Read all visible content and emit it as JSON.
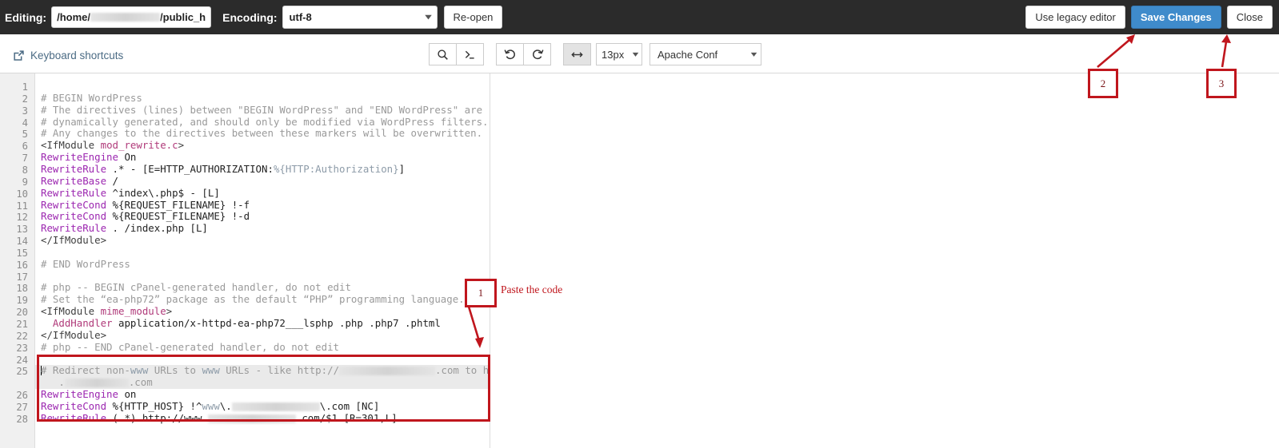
{
  "topbar": {
    "editing_label": "Editing:",
    "path_prefix": "/home/",
    "path_suffix": "/public_h",
    "encoding_label": "Encoding:",
    "encoding_value": "utf-8",
    "reopen_label": "Re-open",
    "legacy_label": "Use legacy editor",
    "save_label": "Save Changes",
    "close_label": "Close",
    "accent_color": "#3f8bcb",
    "bar_color": "#2b2b2b"
  },
  "toolbar": {
    "keyboard_shortcuts_label": "Keyboard shortcuts",
    "search_icon": "search-icon",
    "console_icon": "command-prompt-icon",
    "undo_icon": "undo-icon",
    "redo_icon": "redo-icon",
    "wrap_icon": "word-wrap-icon",
    "font_size_value": "13px",
    "language_value": "Apache Conf"
  },
  "editor": {
    "active_line": 25,
    "lines": [
      {
        "n": 1,
        "segments": []
      },
      {
        "n": 2,
        "segments": [
          {
            "t": "# BEGIN WordPress",
            "c": "c-comment"
          }
        ]
      },
      {
        "n": 3,
        "segments": [
          {
            "t": "# The directives (lines) between \"BEGIN WordPress\" and \"END WordPress\" are",
            "c": "c-comment"
          }
        ]
      },
      {
        "n": 4,
        "segments": [
          {
            "t": "# dynamically generated, and should only be modified via WordPress filters.",
            "c": "c-comment"
          }
        ]
      },
      {
        "n": 5,
        "segments": [
          {
            "t": "# Any changes to the directives between these markers will be overwritten.",
            "c": "c-comment"
          }
        ]
      },
      {
        "n": 6,
        "segments": [
          {
            "t": "<IfModule ",
            "c": "c-tag"
          },
          {
            "t": "mod_rewrite.c",
            "c": "c-attr"
          },
          {
            "t": ">",
            "c": "c-tag"
          }
        ]
      },
      {
        "n": 7,
        "segments": [
          {
            "t": "RewriteEngine",
            "c": "c-dir"
          },
          {
            "t": " On",
            "c": "c-plain"
          }
        ]
      },
      {
        "n": 8,
        "segments": [
          {
            "t": "RewriteRule",
            "c": "c-dir"
          },
          {
            "t": " .* - [E=HTTP_AUTHORIZATION:",
            "c": "c-plain"
          },
          {
            "t": "%{HTTP:Authorization}",
            "c": "c-var"
          },
          {
            "t": "]",
            "c": "c-plain"
          }
        ]
      },
      {
        "n": 9,
        "segments": [
          {
            "t": "RewriteBase",
            "c": "c-dir"
          },
          {
            "t": " /",
            "c": "c-plain"
          }
        ]
      },
      {
        "n": 10,
        "segments": [
          {
            "t": "RewriteRule",
            "c": "c-dir"
          },
          {
            "t": " ^index\\.php$ - [L]",
            "c": "c-plain"
          }
        ]
      },
      {
        "n": 11,
        "segments": [
          {
            "t": "RewriteCond",
            "c": "c-dir"
          },
          {
            "t": " %{REQUEST_FILENAME} !-f",
            "c": "c-plain"
          }
        ]
      },
      {
        "n": 12,
        "segments": [
          {
            "t": "RewriteCond",
            "c": "c-dir"
          },
          {
            "t": " %{REQUEST_FILENAME} !-d",
            "c": "c-plain"
          }
        ]
      },
      {
        "n": 13,
        "segments": [
          {
            "t": "RewriteRule",
            "c": "c-dir"
          },
          {
            "t": " . /index.php [L]",
            "c": "c-plain"
          }
        ]
      },
      {
        "n": 14,
        "segments": [
          {
            "t": "</IfModule>",
            "c": "c-tag"
          }
        ]
      },
      {
        "n": 15,
        "segments": []
      },
      {
        "n": 16,
        "segments": [
          {
            "t": "# END WordPress",
            "c": "c-comment"
          }
        ]
      },
      {
        "n": 17,
        "segments": []
      },
      {
        "n": 18,
        "segments": [
          {
            "t": "# php -- BEGIN cPanel-generated handler, do not edit",
            "c": "c-comment"
          }
        ]
      },
      {
        "n": 19,
        "segments": [
          {
            "t": "# Set the “ea-php72” package as the default “PHP” programming language.",
            "c": "c-comment"
          }
        ]
      },
      {
        "n": 20,
        "segments": [
          {
            "t": "<IfModule ",
            "c": "c-tag"
          },
          {
            "t": "mime_module",
            "c": "c-attr"
          },
          {
            "t": ">",
            "c": "c-tag"
          }
        ]
      },
      {
        "n": 21,
        "segments": [
          {
            "t": "  AddHandler",
            "c": "c-attr"
          },
          {
            "t": " application/x-httpd-ea-php72___lsphp .php .php7 .phtml",
            "c": "c-plain"
          }
        ]
      },
      {
        "n": 22,
        "segments": [
          {
            "t": "</IfModule>",
            "c": "c-tag"
          }
        ]
      },
      {
        "n": 23,
        "segments": [
          {
            "t": "# php -- END cPanel-generated handler, do not edit",
            "c": "c-comment"
          }
        ]
      },
      {
        "n": 24,
        "segments": []
      },
      {
        "n": 25,
        "segments": [
          {
            "t": "# Redirect non-",
            "c": "c-comment"
          },
          {
            "t": "www",
            "c": "c-var"
          },
          {
            "t": " URLs to ",
            "c": "c-comment"
          },
          {
            "t": "www",
            "c": "c-var"
          },
          {
            "t": " URLs - like http://",
            "c": "c-comment"
          },
          {
            "t": "[redacted]",
            "c": "redacted"
          },
          {
            "t": ".com to http://www",
            "c": "c-comment"
          }
        ],
        "wrapped": [
          {
            "t": "   .",
            "c": "c-comment"
          },
          {
            "t": "[redacted]",
            "c": "redacted"
          },
          {
            "t": ".com",
            "c": "c-comment"
          }
        ]
      },
      {
        "n": 26,
        "segments": [
          {
            "t": "RewriteEngine",
            "c": "c-dir"
          },
          {
            "t": " on",
            "c": "c-plain"
          }
        ]
      },
      {
        "n": 27,
        "segments": [
          {
            "t": "RewriteCond",
            "c": "c-dir"
          },
          {
            "t": " %{HTTP_HOST} !^",
            "c": "c-plain"
          },
          {
            "t": "www",
            "c": "c-var"
          },
          {
            "t": "\\.",
            "c": "c-plain"
          },
          {
            "t": "[redacted]",
            "c": "redacted"
          },
          {
            "t": "\\.com [NC]",
            "c": "c-plain"
          }
        ]
      },
      {
        "n": 28,
        "segments": [
          {
            "t": "RewriteRule",
            "c": "c-dir"
          },
          {
            "t": " (.*) http://www.",
            "c": "c-plain"
          },
          {
            "t": "[redacted]",
            "c": "redacted"
          },
          {
            "t": ".com/$1 [R=301,L]",
            "c": "c-plain"
          }
        ]
      }
    ]
  },
  "annotations": {
    "color": "#c0161d",
    "items": [
      {
        "number": "1",
        "label": "Paste the code"
      },
      {
        "number": "2",
        "label": ""
      },
      {
        "number": "3",
        "label": ""
      }
    ]
  }
}
